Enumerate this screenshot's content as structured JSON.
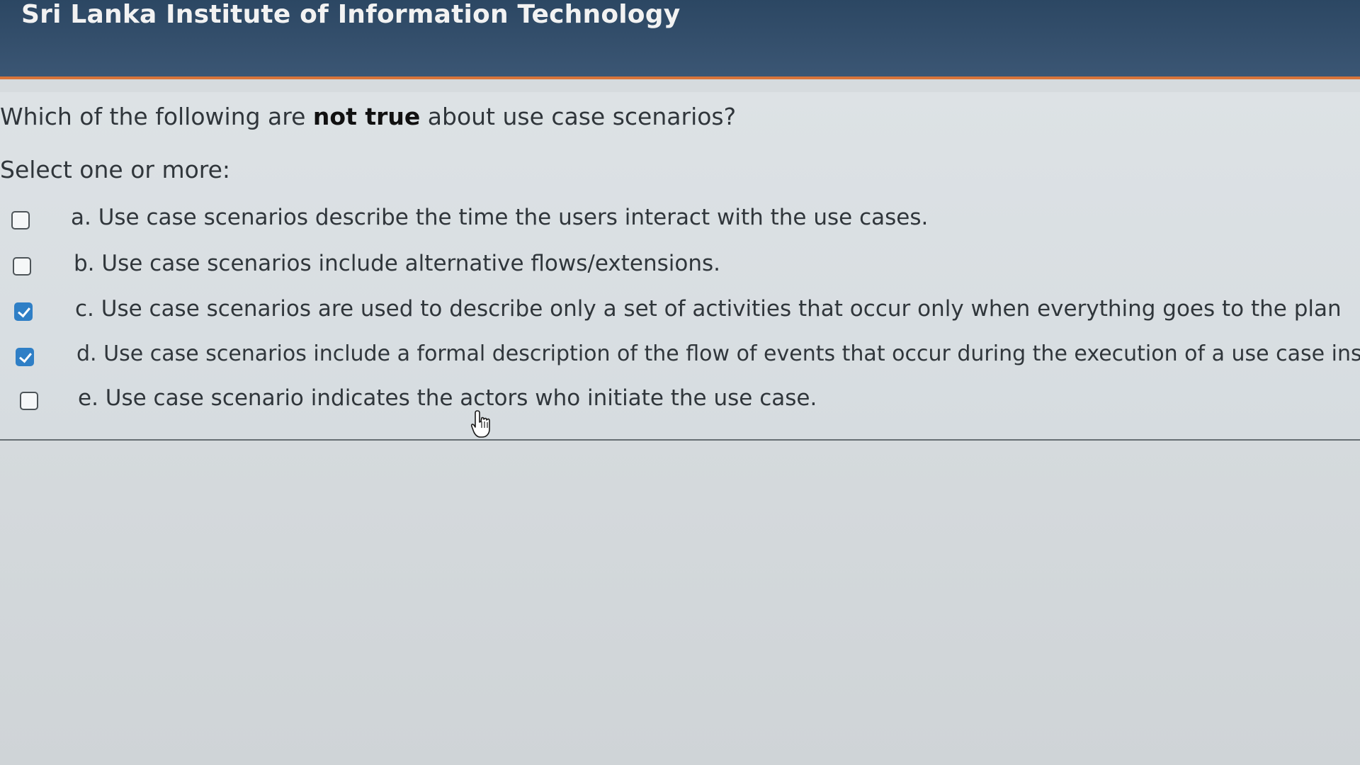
{
  "header": {
    "site_title": "Sri Lanka Institute of Information Technology"
  },
  "question": {
    "text_before": "Which of the following are ",
    "text_emphasis": "not true",
    "text_after": " about use case scenarios?",
    "prompt": "Select one or more:",
    "options": [
      {
        "label": "a. Use case scenarios describe the time the users interact with the use cases.",
        "checked": false
      },
      {
        "label": "b. Use case scenarios include alternative flows/extensions.",
        "checked": false
      },
      {
        "label": "c. Use case scenarios are used to describe only a set of activities that occur only when everything goes to the plan",
        "checked": true
      },
      {
        "label": "d. Use case scenarios include a  formal description of the flow of events that occur during the execution of a use case instance.",
        "checked": true
      },
      {
        "label": "e. Use case scenario indicates the actors who initiate the use case.",
        "checked": false
      }
    ]
  },
  "colors": {
    "header_bg": "#2c4763",
    "header_accent": "#d9743a",
    "checkbox_checked": "#2f7fc6"
  },
  "icons": {
    "cursor": "hand-pointer-icon",
    "checkbox_checked": "checkmark-icon"
  }
}
